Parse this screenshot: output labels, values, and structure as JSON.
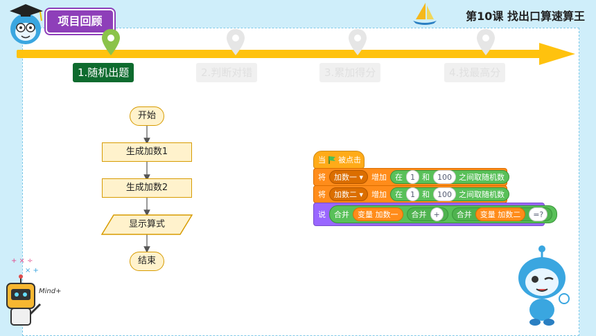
{
  "header": {
    "project_tag": "项目回顾",
    "lesson_title": "第10课   找出口算速算王"
  },
  "steps": [
    {
      "label": "1.随机出题",
      "state": "active"
    },
    {
      "label": "2.判断对错",
      "state": "inactive"
    },
    {
      "label": "3.累加得分",
      "state": "inactive"
    },
    {
      "label": "4.找最高分",
      "state": "inactive"
    }
  ],
  "flowchart": {
    "start": "开始",
    "step1": "生成加数1",
    "step2": "生成加数2",
    "io": "显示算式",
    "end": "结束"
  },
  "scratch": {
    "hat": {
      "prefix": "当",
      "suffix": "被点击"
    },
    "line1": {
      "verb": "将",
      "var": "加数一 ▾",
      "action": "增加",
      "in": "在",
      "min": "1",
      "and": "和",
      "max": "100",
      "tail": "之间取随机数"
    },
    "line2": {
      "verb": "将",
      "var": "加数二 ▾",
      "action": "增加",
      "in": "在",
      "min": "1",
      "and": "和",
      "max": "100",
      "tail": "之间取随机数"
    },
    "say": {
      "verb": "说",
      "join1": "合并",
      "var1": "变量 加数一",
      "join2": "合并",
      "plus": "+",
      "join3": "合并",
      "var2": "变量 加数二",
      "eq": "=?"
    }
  },
  "decor": {
    "mind_logo": "Mind+"
  },
  "colors": {
    "accent_purple": "#8e3fb9",
    "timeline": "#ffc20e",
    "active_step": "#0e6b2e"
  }
}
